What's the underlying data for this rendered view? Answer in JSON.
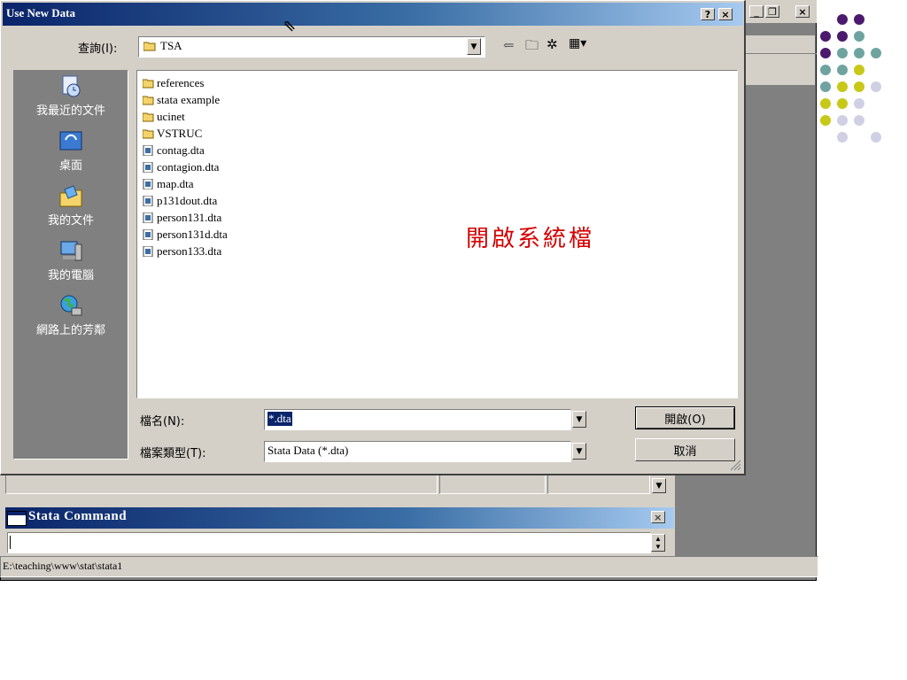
{
  "app": {
    "cmd_title": "Stata Command",
    "status_path": "E:\\teaching\\www\\stat\\stata1"
  },
  "dialog": {
    "title": "Use New Data",
    "lookin_label": "查詢(I):",
    "lookin_value": "TSA",
    "places": [
      {
        "label": "我最近的文件",
        "icon": "recent-documents-icon"
      },
      {
        "label": "桌面",
        "icon": "desktop-icon"
      },
      {
        "label": "我的文件",
        "icon": "my-documents-icon"
      },
      {
        "label": "我的電腦",
        "icon": "my-computer-icon"
      },
      {
        "label": "網路上的芳鄰",
        "icon": "network-places-icon"
      }
    ],
    "files": [
      {
        "name": "references",
        "type": "folder"
      },
      {
        "name": "stata example",
        "type": "folder"
      },
      {
        "name": "ucinet",
        "type": "folder"
      },
      {
        "name": "VSTRUC",
        "type": "folder"
      },
      {
        "name": "contag.dta",
        "type": "file"
      },
      {
        "name": "contagion.dta",
        "type": "file"
      },
      {
        "name": "map.dta",
        "type": "file"
      },
      {
        "name": "p131dout.dta",
        "type": "file"
      },
      {
        "name": "person131.dta",
        "type": "file"
      },
      {
        "name": "person131d.dta",
        "type": "file"
      },
      {
        "name": "person133.dta",
        "type": "file"
      }
    ],
    "filename_label": "檔名(N):",
    "filename_value": "*.dta",
    "filetype_label": "檔案類型(T):",
    "filetype_value": "Stata Data (*.dta)",
    "open_button": "開啟(O)",
    "cancel_button": "取消",
    "help_button": "?",
    "close_button": "×"
  },
  "annotation": "開啟系統檔",
  "colors": {
    "titlebar_start": "#0a246a",
    "titlebar_end": "#a6caf0",
    "annotation": "#d40000",
    "dot_purple": "#4b1a6e",
    "dot_teal": "#6fa3a0",
    "dot_yellow": "#c8c818",
    "dot_lavender": "#d0d0e4"
  }
}
